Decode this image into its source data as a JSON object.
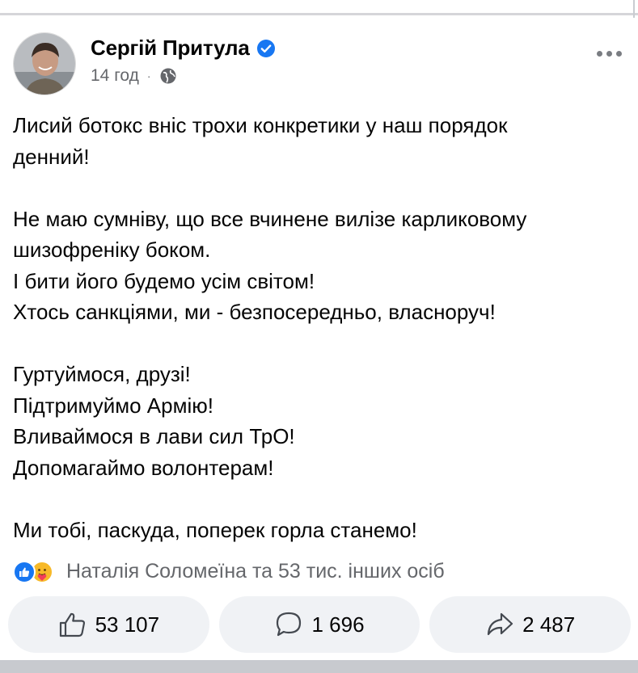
{
  "post": {
    "author": "Сергій Притула",
    "verified": true,
    "time": "14 год",
    "separator": "·",
    "privacy_icon": "globe-icon",
    "paragraphs": [
      [
        "Лисий ботокс вніс трохи конкретики у наш порядок",
        "денний!"
      ],
      [
        "Не маю сумніву, що все вчинене вилізе карликовому",
        "шизофреніку боком.",
        "І бити його будемо усім світом!",
        "Хтось санкціями, ми - безпосередньо, власноруч!"
      ],
      [
        "Гуртуймося, друзі!",
        "Підтримуймо Армію!",
        "Вливаймося в лави сил ТрО!",
        "Допомагаймо волонтерам!"
      ],
      [
        "Ми тобі, паскуда, поперек горла станемо!"
      ]
    ]
  },
  "reactions": {
    "icons": [
      "like-icon",
      "care-icon"
    ],
    "summary": "Наталія Соломеїна та 53 тис. інших осіб"
  },
  "actions": {
    "like": {
      "icon": "thumbs-up-icon",
      "count": "53 107"
    },
    "comment": {
      "icon": "comment-icon",
      "count": "1 696"
    },
    "share": {
      "icon": "share-icon",
      "count": "2 487"
    }
  },
  "colors": {
    "text": "#050505",
    "secondary": "#65676b",
    "verified_blue": "#1877f2",
    "button_bg": "#f0f2f5"
  }
}
